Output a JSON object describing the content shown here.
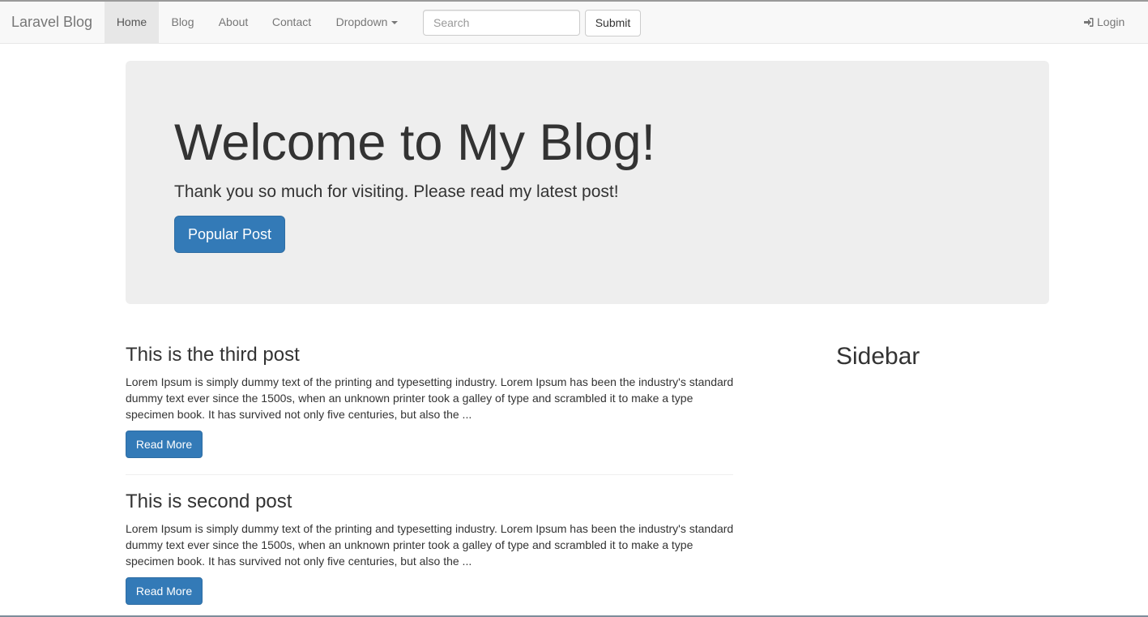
{
  "navbar": {
    "brand": "Laravel Blog",
    "items": [
      {
        "label": "Home",
        "active": true
      },
      {
        "label": "Blog",
        "active": false
      },
      {
        "label": "About",
        "active": false
      },
      {
        "label": "Contact",
        "active": false
      },
      {
        "label": "Dropdown",
        "active": false
      }
    ],
    "search": {
      "placeholder": "Search",
      "value": ""
    },
    "submit_label": "Submit",
    "login_label": "Login",
    "login_icon": "sign-in-icon"
  },
  "jumbotron": {
    "title": "Welcome to My Blog!",
    "lead": "Thank you so much for visiting. Please read my latest post!",
    "button_label": "Popular Post"
  },
  "posts": [
    {
      "title": "This is the third post",
      "excerpt": "Lorem Ipsum is simply dummy text of the printing and typesetting industry. Lorem Ipsum has been the industry's standard dummy text ever since the 1500s, when an unknown printer took a galley of type and scrambled it to make a type specimen book. It has survived not only five centuries, but also the ...",
      "button_label": "Read More"
    },
    {
      "title": "This is second post",
      "excerpt": "Lorem Ipsum is simply dummy text of the printing and typesetting industry. Lorem Ipsum has been the industry's standard dummy text ever since the 1500s, when an unknown printer took a galley of type and scrambled it to make a type specimen book. It has survived not only five centuries, but also the ...",
      "button_label": "Read More"
    }
  ],
  "sidebar": {
    "title": "Sidebar"
  },
  "colors": {
    "primary": "#337ab7",
    "navbar_bg": "#f8f8f8",
    "jumbotron_bg": "#eeeeee",
    "text": "#333333",
    "nav_text": "#777777"
  }
}
